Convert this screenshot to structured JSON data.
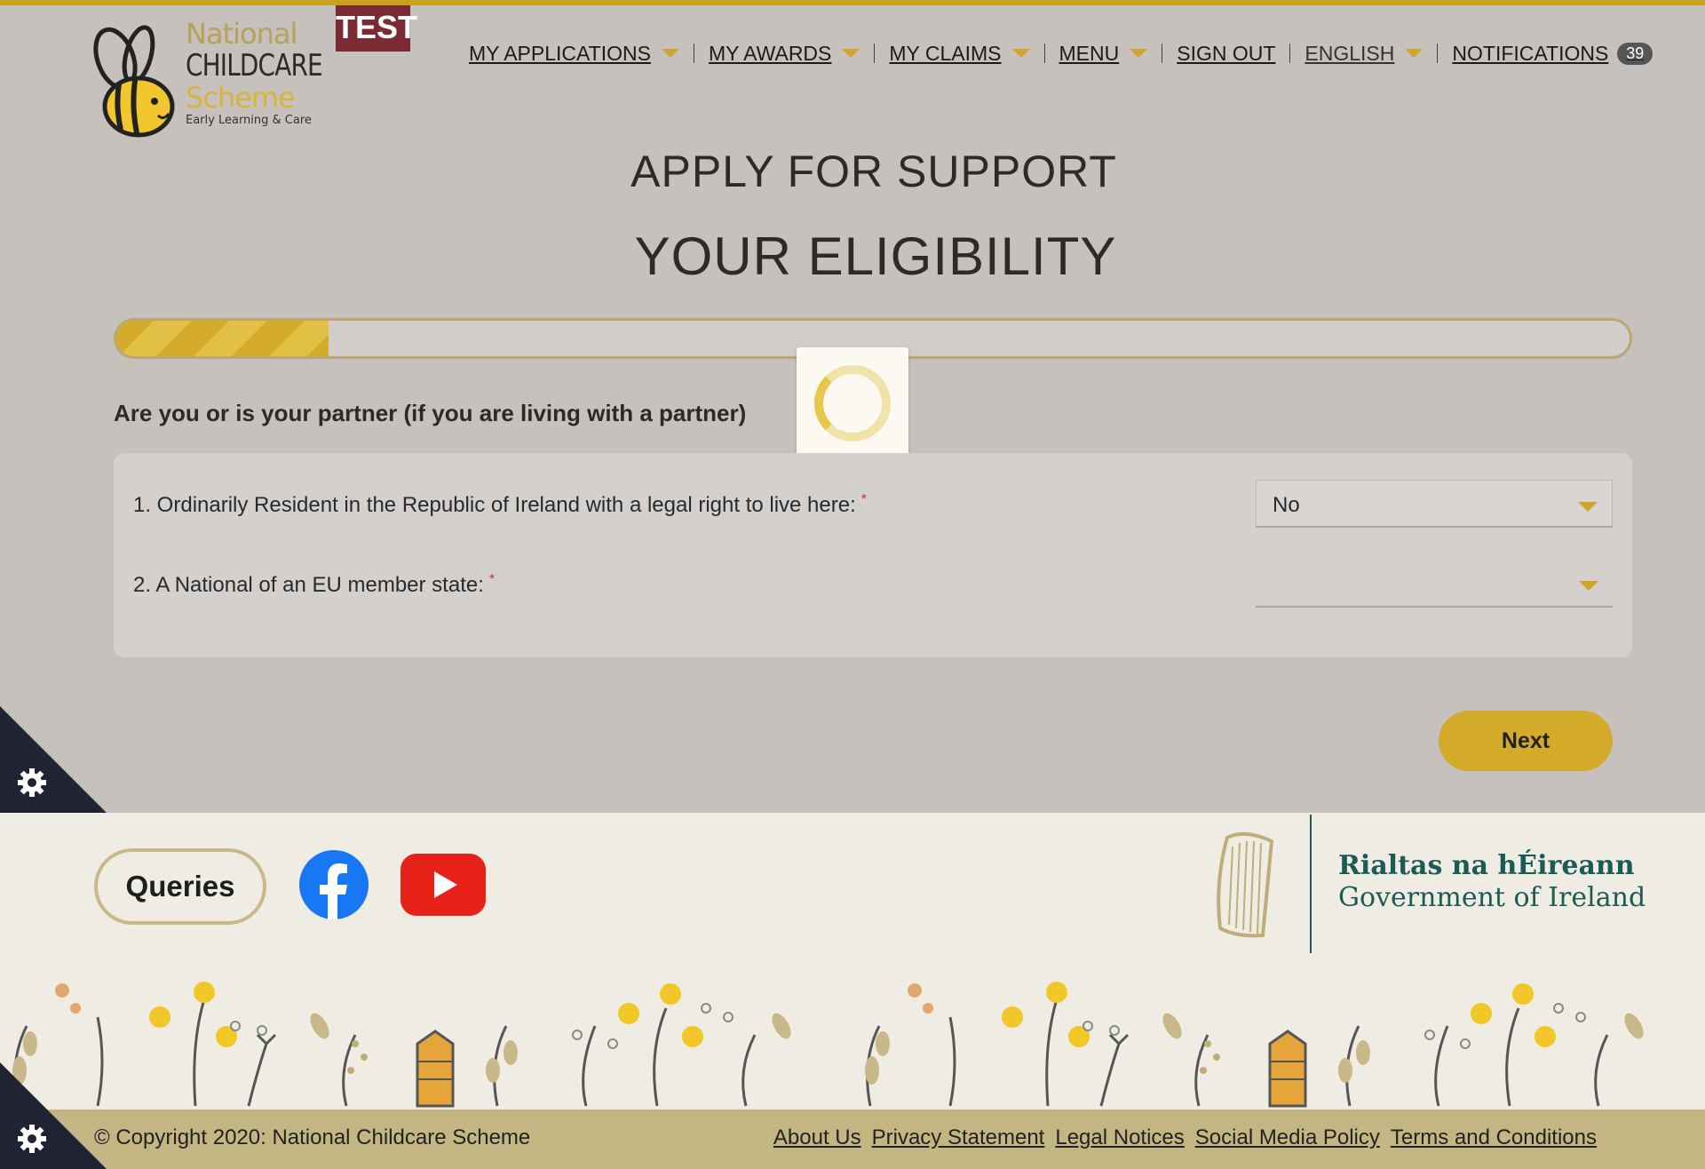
{
  "header": {
    "logo": {
      "line1": "National",
      "line2": "CHILDCARE",
      "line3": "Scheme",
      "line4": "Early Learning & Care"
    },
    "env_badge": "TEST",
    "nav": {
      "my_applications": "MY APPLICATIONS",
      "my_awards": "MY AWARDS",
      "my_claims": "MY CLAIMS",
      "menu": "MENU",
      "sign_out": "SIGN OUT",
      "language": "ENGLISH",
      "notifications": "NOTIFICATIONS",
      "notifications_count": "39"
    }
  },
  "main": {
    "title": "APPLY FOR SUPPORT",
    "subtitle": "YOUR ELIGIBILITY",
    "progress_fraction": 0.14,
    "question": "Are you or is your partner (if you are living with a partner)",
    "fields": [
      {
        "label": "1. Ordinarily Resident in the Republic of Ireland with a legal right to live here:",
        "required": "*",
        "value": "No"
      },
      {
        "label": "2. A National of an EU member state:",
        "required": "*",
        "value": ""
      }
    ],
    "next_label": "Next"
  },
  "footer": {
    "queries_label": "Queries",
    "gov_irish": "Rialtas na hÉireann",
    "gov_english": "Government of Ireland",
    "copyright": "© Copyright 2020: National Childcare Scheme",
    "links": [
      "About Us",
      "Privacy Statement",
      "Legal Notices",
      "Social Media Policy",
      "Terms and Conditions"
    ]
  },
  "colors": {
    "accent": "#d4aa2a",
    "page_bg": "#c6c1bd",
    "test_badge": "#7a2b33",
    "gov_green": "#1c5a55"
  },
  "icons": [
    "bee-logo-icon",
    "facebook-icon",
    "youtube-icon",
    "harp-icon",
    "gear-icon",
    "spinner-icon"
  ]
}
